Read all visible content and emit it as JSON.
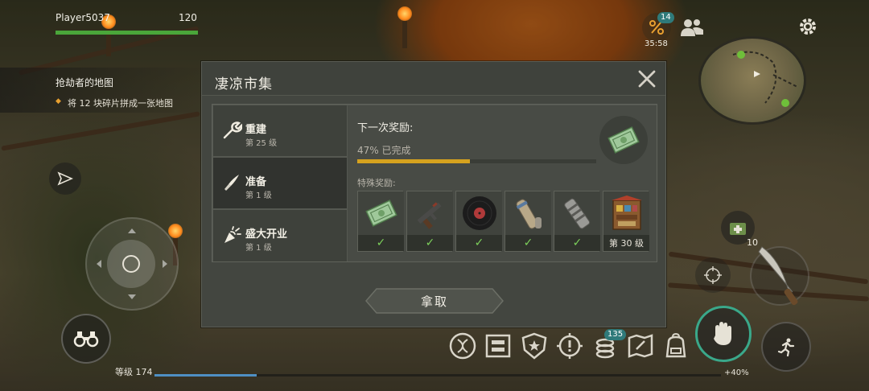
{
  "hud": {
    "player_name": "Player5037",
    "player_hp": "120",
    "quest_title": "抢劫者的地图",
    "quest_desc": "将 12 块碎片拼成一张地图",
    "level_label": "等级 174",
    "xp_bonus": "+40%",
    "xp_progress": 0.18,
    "hp_progress": 1.0,
    "discount_badge": "14",
    "timer": "35:58",
    "coins_badge": "135",
    "ammo_count": "10"
  },
  "dialog": {
    "title": "凄凉市集",
    "categories": [
      {
        "label": "重建",
        "sub": "第 25 级"
      },
      {
        "label": "准备",
        "sub": "第 1 级"
      },
      {
        "label": "盛大开业",
        "sub": "第 1 级"
      }
    ],
    "next_reward_label": "下一次奖励:",
    "progress_text": "47% 已完成",
    "progress_value": 0.47,
    "special_rewards_label": "特殊奖励:",
    "special_rewards": [
      {
        "icon": "money-icon",
        "status": "claimed"
      },
      {
        "icon": "gun-icon",
        "status": "claimed"
      },
      {
        "icon": "vinyl-record-icon",
        "status": "claimed"
      },
      {
        "icon": "tube-icon",
        "status": "claimed"
      },
      {
        "icon": "silencer-icon",
        "status": "claimed"
      },
      {
        "icon": "shop-crate-icon",
        "status": "locked",
        "label": "第 30 级"
      }
    ],
    "claim_label": "拿取"
  },
  "colors": {
    "accent_progress": "#d6a21e",
    "check_green": "#7ccf5a",
    "hp_green": "#4aa63a",
    "xp_blue": "#4e8fc4"
  }
}
